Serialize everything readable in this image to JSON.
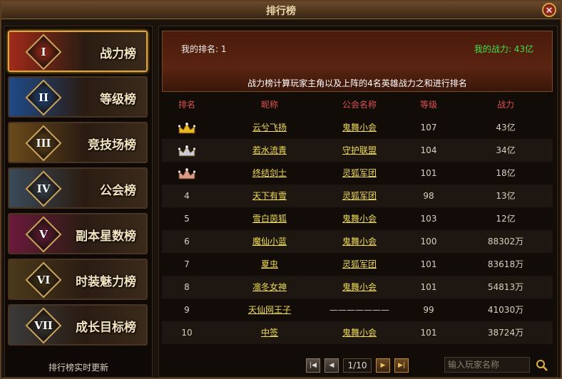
{
  "window": {
    "title": "排行榜",
    "close_icon": "✕"
  },
  "sidebar": {
    "items": [
      {
        "roman": "I",
        "label": "战力榜",
        "color": "#a02a1a"
      },
      {
        "roman": "II",
        "label": "等级榜",
        "color": "#1f4a8a"
      },
      {
        "roman": "III",
        "label": "竞技场榜",
        "color": "#6a4a1a"
      },
      {
        "roman": "IV",
        "label": "公会榜",
        "color": "#3a4a5a"
      },
      {
        "roman": "V",
        "label": "副本星数榜",
        "color": "#6a1a3a"
      },
      {
        "roman": "VI",
        "label": "时装魅力榜",
        "color": "#4a3a1a"
      },
      {
        "roman": "VII",
        "label": "成长目标榜",
        "color": "#3a3a3a"
      }
    ],
    "footer": "排行榜实时更新"
  },
  "banner": {
    "my_rank": "我的排名: 1",
    "my_power": "我的战力: 43亿",
    "description": "战力榜计算玩家主角以及上阵的4名英雄战力之和进行排名"
  },
  "table": {
    "headers": {
      "rank": "排名",
      "name": "昵称",
      "guild": "公会名称",
      "level": "等级",
      "power": "战力"
    },
    "rows": [
      {
        "rank": "1",
        "name": "云兮飞扬",
        "guild": "鬼舞小会",
        "level": "107",
        "power": "43亿"
      },
      {
        "rank": "2",
        "name": "若水流青",
        "guild": "守护联盟",
        "level": "104",
        "power": "34亿"
      },
      {
        "rank": "3",
        "name": "终结剑士",
        "guild": "灵狐军团",
        "level": "101",
        "power": "18亿"
      },
      {
        "rank": "4",
        "name": "天下有雪",
        "guild": "灵狐军团",
        "level": "98",
        "power": "13亿"
      },
      {
        "rank": "5",
        "name": "雪白茵狐",
        "guild": "鬼舞小会",
        "level": "103",
        "power": "12亿"
      },
      {
        "rank": "6",
        "name": "魔仙小蓝",
        "guild": "鬼舞小会",
        "level": "100",
        "power": "88302万"
      },
      {
        "rank": "7",
        "name": "夏虫",
        "guild": "灵狐军团",
        "level": "101",
        "power": "83618万"
      },
      {
        "rank": "8",
        "name": "凛冬女神",
        "guild": "鬼舞小会",
        "level": "101",
        "power": "54813万"
      },
      {
        "rank": "9",
        "name": "天仙网王子",
        "guild": "———————",
        "level": "99",
        "power": "41030万"
      },
      {
        "rank": "10",
        "name": "中签",
        "guild": "鬼舞小会",
        "level": "101",
        "power": "38724万"
      }
    ],
    "crown_colors": [
      "#e8b820",
      "#c8ccd4",
      "#d89a8a"
    ]
  },
  "pager": {
    "indicator": "1/10",
    "first_icon": "|◀",
    "prev_icon": "◀",
    "next_icon": "▶",
    "last_icon": "▶|"
  },
  "search": {
    "placeholder": "输入玩家名称",
    "value": ""
  }
}
